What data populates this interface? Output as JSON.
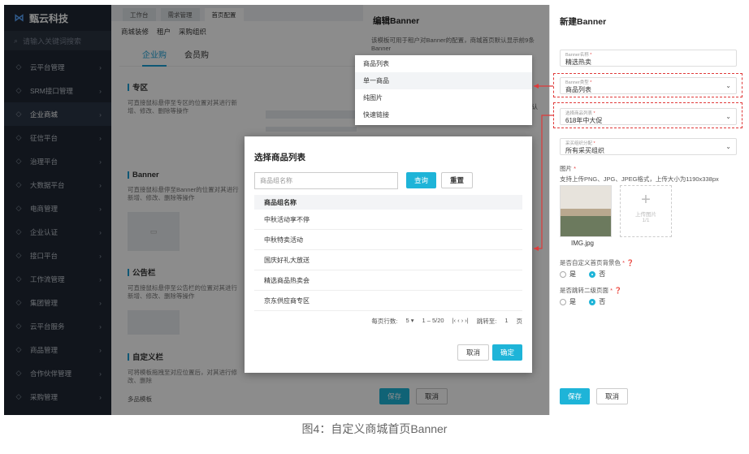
{
  "app": {
    "logo": "甄云科技",
    "search_placeholder": "请输入关键词搜索"
  },
  "sidebar": {
    "items": [
      {
        "label": "云平台管理",
        "icon": "cloud-icon"
      },
      {
        "label": "SRM接口管理",
        "icon": "api-icon"
      },
      {
        "label": "企业商城",
        "icon": "mall-icon"
      },
      {
        "label": "征信平台",
        "icon": "credit-icon"
      },
      {
        "label": "治理平台",
        "icon": "governance-icon"
      },
      {
        "label": "大数据平台",
        "icon": "bigdata-icon"
      },
      {
        "label": "电商管理",
        "icon": "ecommerce-icon"
      },
      {
        "label": "企业认证",
        "icon": "cert-icon"
      },
      {
        "label": "接口平台",
        "icon": "interface-icon"
      },
      {
        "label": "工作流管理",
        "icon": "workflow-icon"
      },
      {
        "label": "集团管理",
        "icon": "group-icon"
      },
      {
        "label": "云平台服务",
        "icon": "service-icon"
      },
      {
        "label": "商品管理",
        "icon": "goods-icon"
      },
      {
        "label": "合作伙伴管理",
        "icon": "partner-icon"
      },
      {
        "label": "采购管理",
        "icon": "purchase-icon"
      }
    ],
    "arrow": "›"
  },
  "main": {
    "top_tabs": [
      "工作台",
      "需求管理",
      "首页配置"
    ],
    "sub_nav": [
      "商城装修",
      "租户",
      "采购组织"
    ],
    "tabs": [
      "企业购",
      "会员购"
    ],
    "sections": [
      {
        "title": "专区",
        "desc": "可直接鼠标悬停至专区的位置对其进行新增、修改、删除等操作"
      },
      {
        "title": "Banner",
        "desc": "可直接鼠标悬停至Banner的位置对其进行新增、修改、删除等操作"
      },
      {
        "title": "公告栏",
        "desc": "可直接鼠标悬停至公告栏的位置对其进行新增、修改、删除等操作"
      },
      {
        "title": "自定义栏",
        "desc": "可将模板拖拽至对应位置后，对其进行修改、删除"
      }
    ],
    "multi_template": "多品模板"
  },
  "edit": {
    "title": "编辑Banner",
    "desc": "该模板可用于租户对Banner的配置，商城首页默认显示前9条Banner",
    "col_hint": "默认",
    "save": "保存",
    "cancel": "取消"
  },
  "dropdown": {
    "items": [
      "商品列表",
      "单一商品",
      "纯图片",
      "快速链接"
    ]
  },
  "modal": {
    "title": "选择商品列表",
    "search_placeholder": "商品组名称",
    "query": "查询",
    "reset": "重置",
    "header": "商品组名称",
    "rows": [
      "中秋活动享不停",
      "中秋特卖活动",
      "国庆好礼大放送",
      "精选商品热卖会",
      "京东供应商专区"
    ],
    "pager": {
      "page_size_label": "每页行数:",
      "page_size": "5 ▾",
      "range": "1 – 5/20",
      "nav": "|‹  ‹   ›  ›|",
      "jump_label": "跳转至:",
      "jump_page": "1",
      "page_unit": "页"
    },
    "cancel": "取消",
    "ok": "确定"
  },
  "panel": {
    "title": "新建Banner",
    "fields": [
      {
        "label": "Banner名称",
        "value": "精选热卖"
      },
      {
        "label": "Banner类型",
        "value": "商品列表"
      },
      {
        "label": "选择商品列表",
        "value": "618年中大促"
      },
      {
        "label": "采买组织分配",
        "value": "所有采买组织"
      }
    ],
    "image_label": "图片",
    "image_hint": "支持上传PNG、JPG、JPEG格式，上传大小为1190x338px",
    "image_name": "IMG.jpg",
    "upload_label": "上传图片",
    "upload_count": "1/1",
    "bg_question": "是否自定义首页背景色",
    "jump_question": "是否跳转二级页面",
    "yes": "是",
    "no": "否",
    "save": "保存",
    "cancel": "取消"
  },
  "caption": "图4：自定义商城首页Banner",
  "colors": {
    "accent": "#1eb4d8",
    "sidebar": "#1f2733",
    "highlight": "#e03a3a"
  }
}
